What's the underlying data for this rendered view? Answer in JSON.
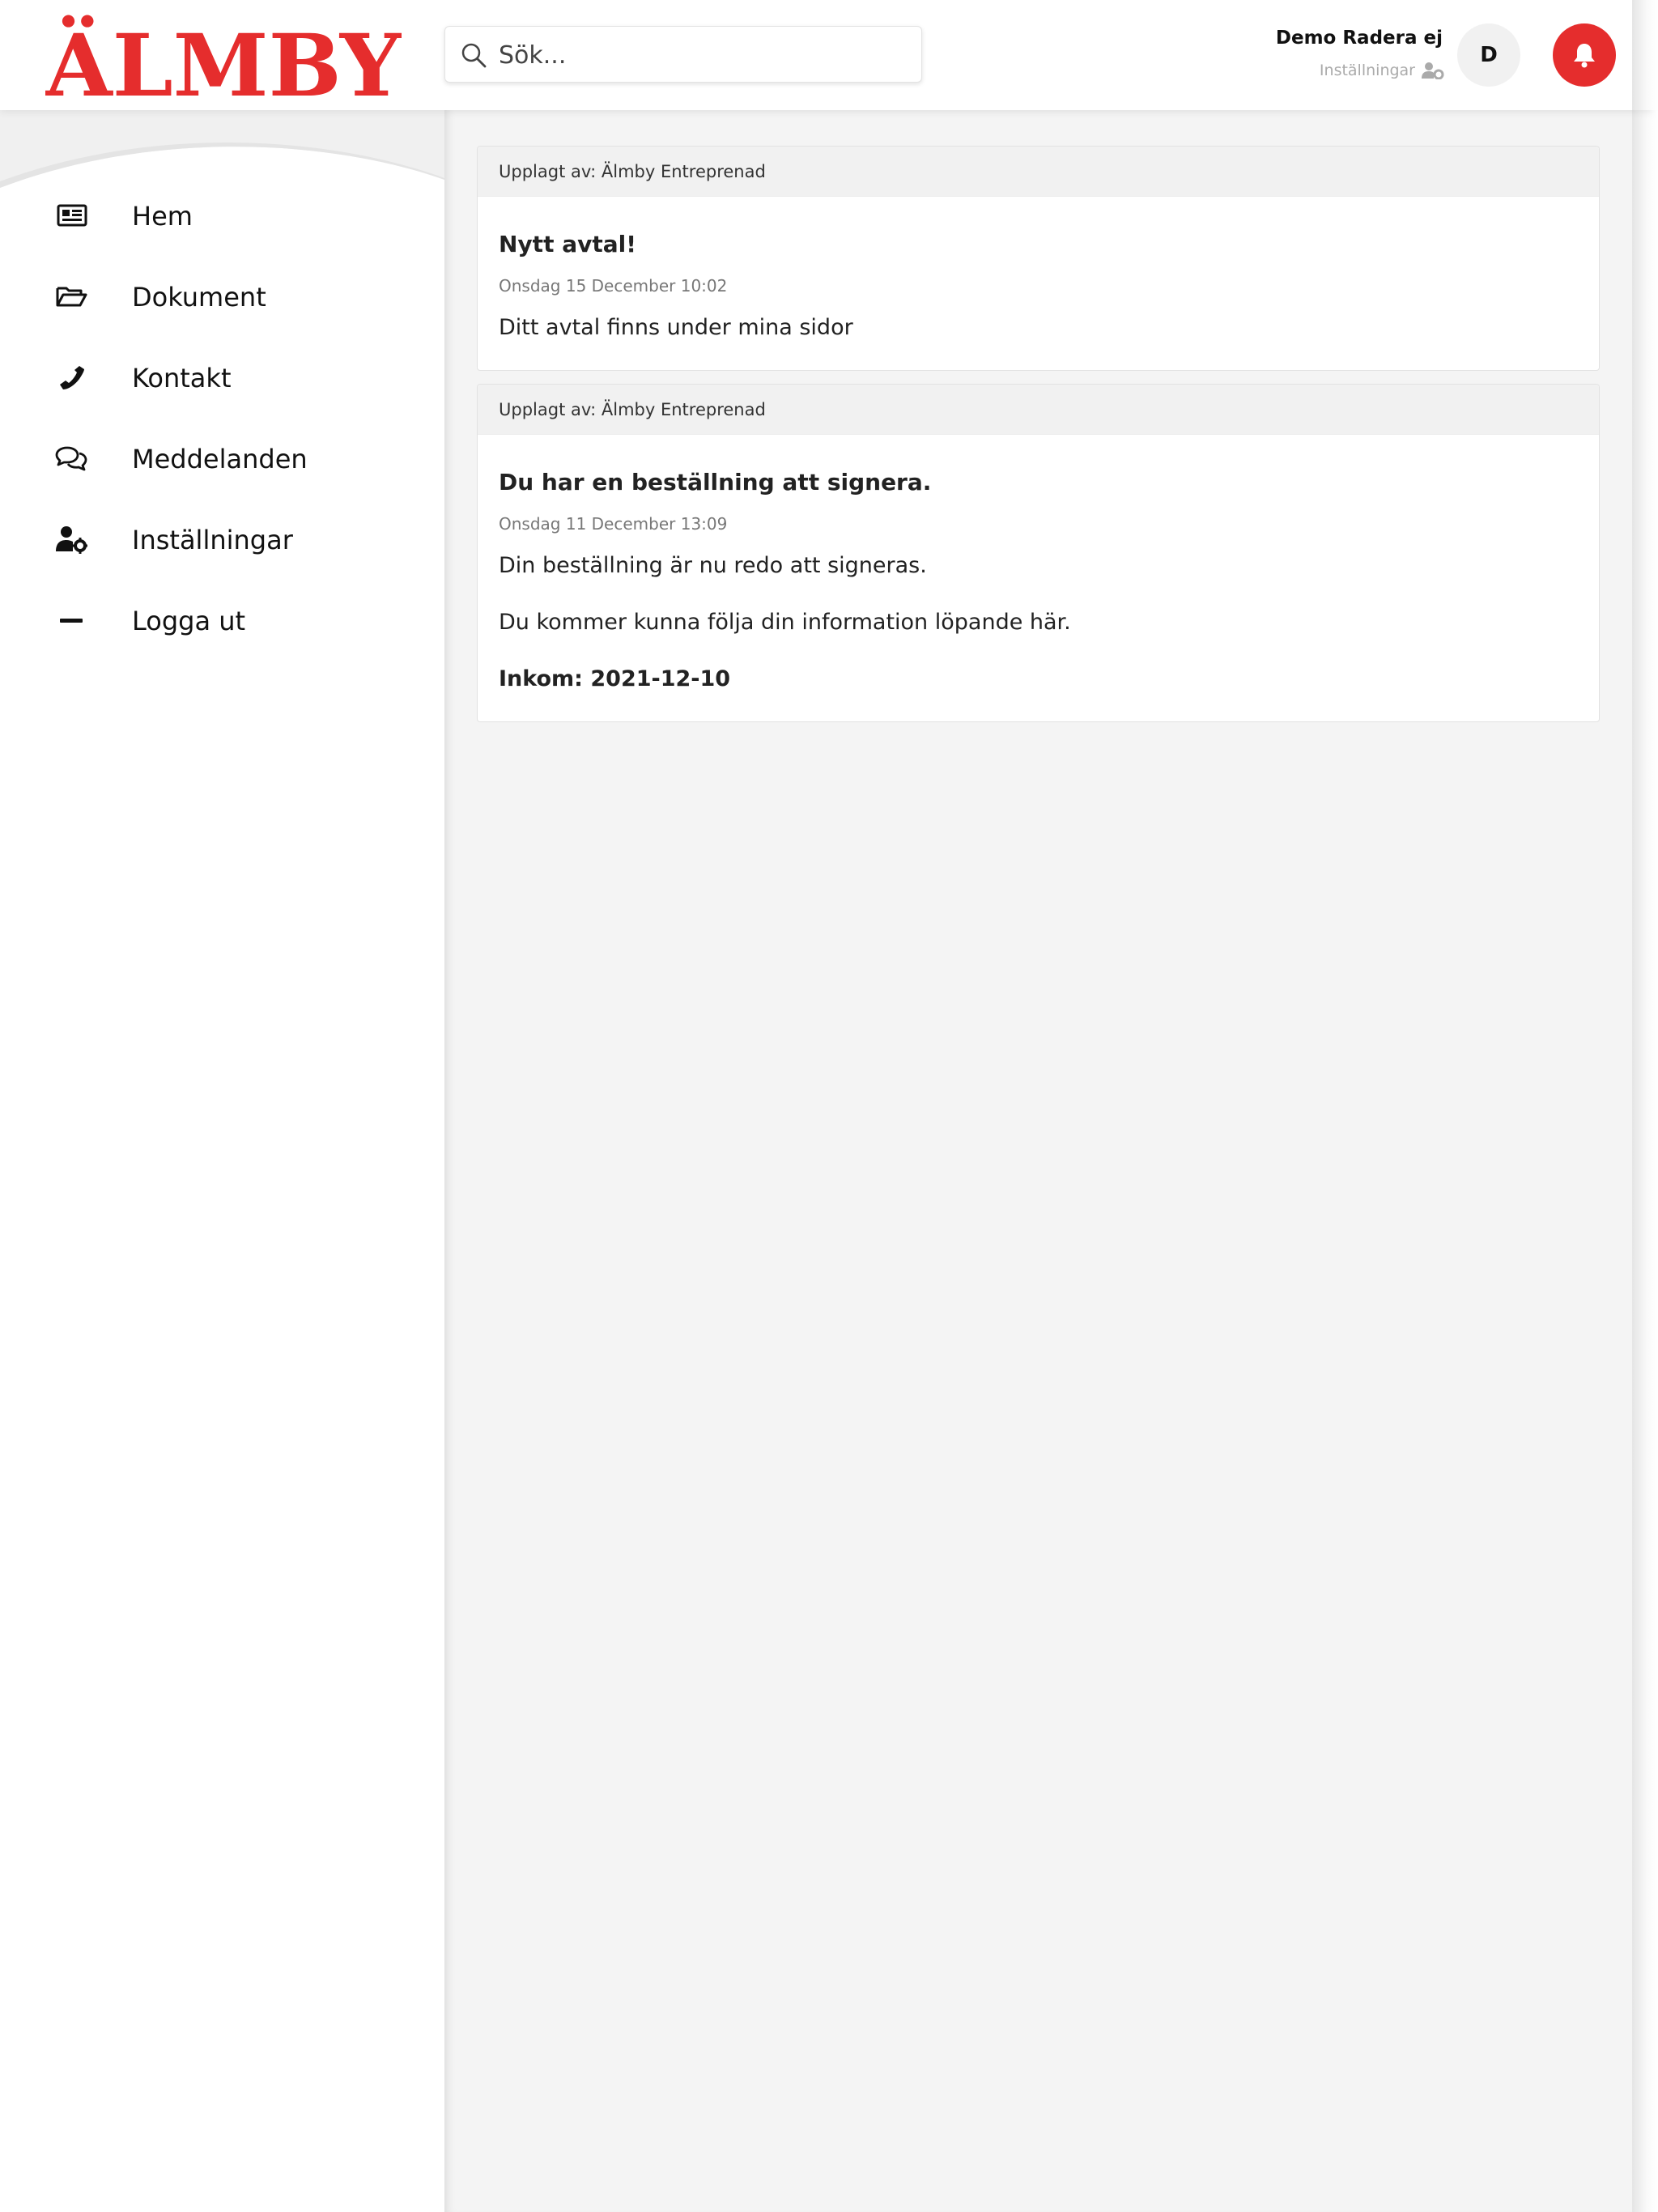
{
  "brand": {
    "logo_text": "ÄLMBY",
    "color": "#e52d2d"
  },
  "search": {
    "placeholder": "Sök..."
  },
  "user": {
    "name": "Demo Radera ej",
    "settings_label": "Inställningar",
    "avatar_initial": "D"
  },
  "icons": {
    "search": "search-icon",
    "bell": "bell-icon",
    "user_settings": "user-gear-icon"
  },
  "sidebar": {
    "items": [
      {
        "label": "Hem",
        "icon": "newspaper-icon"
      },
      {
        "label": "Dokument",
        "icon": "folder-open-icon"
      },
      {
        "label": "Kontakt",
        "icon": "phone-icon"
      },
      {
        "label": "Meddelanden",
        "icon": "comments-icon"
      },
      {
        "label": "Inställningar",
        "icon": "user-gear-icon"
      },
      {
        "label": "Logga ut",
        "icon": "minus-icon"
      }
    ]
  },
  "posts": [
    {
      "posted_by": "Upplagt av: Älmby Entreprenad",
      "title": "Nytt avtal!",
      "date": "Onsdag 15 December 10:02",
      "body": [
        "Ditt avtal finns under mina sidor"
      ]
    },
    {
      "posted_by": "Upplagt av: Älmby Entreprenad",
      "title": "Du har en beställning att signera.",
      "date": "Onsdag 11 December 13:09",
      "body": [
        "Din beställning är nu redo att signeras.",
        "Du kommer kunna följa din information löpande här."
      ],
      "strong": "Inkom: 2021-12-10"
    }
  ]
}
